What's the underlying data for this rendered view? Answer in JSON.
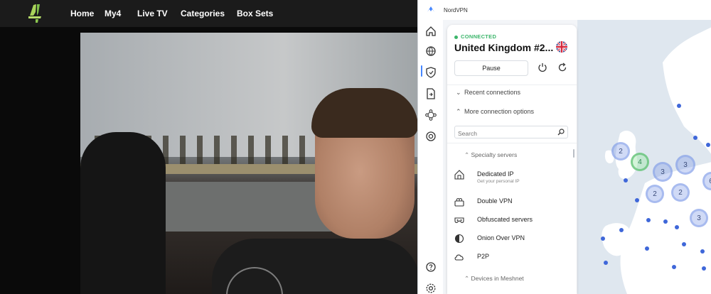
{
  "c4": {
    "nav": [
      "Home",
      "My4",
      "Live TV",
      "Categories",
      "Box Sets"
    ]
  },
  "nord": {
    "app_title": "NordVPN",
    "status": "CONNECTED",
    "server": "United Kingdom #2...",
    "pause_label": "Pause",
    "recent_connections": "Recent connections",
    "more_options": "More connection options",
    "search_placeholder": "Search",
    "specialty_servers": "Specialty servers",
    "items": [
      {
        "label": "Dedicated IP",
        "desc": "Get your personal IP"
      },
      {
        "label": "Double VPN",
        "desc": ""
      },
      {
        "label": "Obfuscated servers",
        "desc": ""
      },
      {
        "label": "Onion Over VPN",
        "desc": ""
      },
      {
        "label": "P2P",
        "desc": ""
      }
    ],
    "devices_meshnet": "Devices in Meshnet",
    "map_clusters": [
      "2",
      "4",
      "3",
      "3",
      "2",
      "2",
      "3",
      "6"
    ],
    "colors": {
      "connected": "#3bb56a",
      "accent": "#4687ff",
      "map_bg": "#dfe7ef"
    }
  }
}
